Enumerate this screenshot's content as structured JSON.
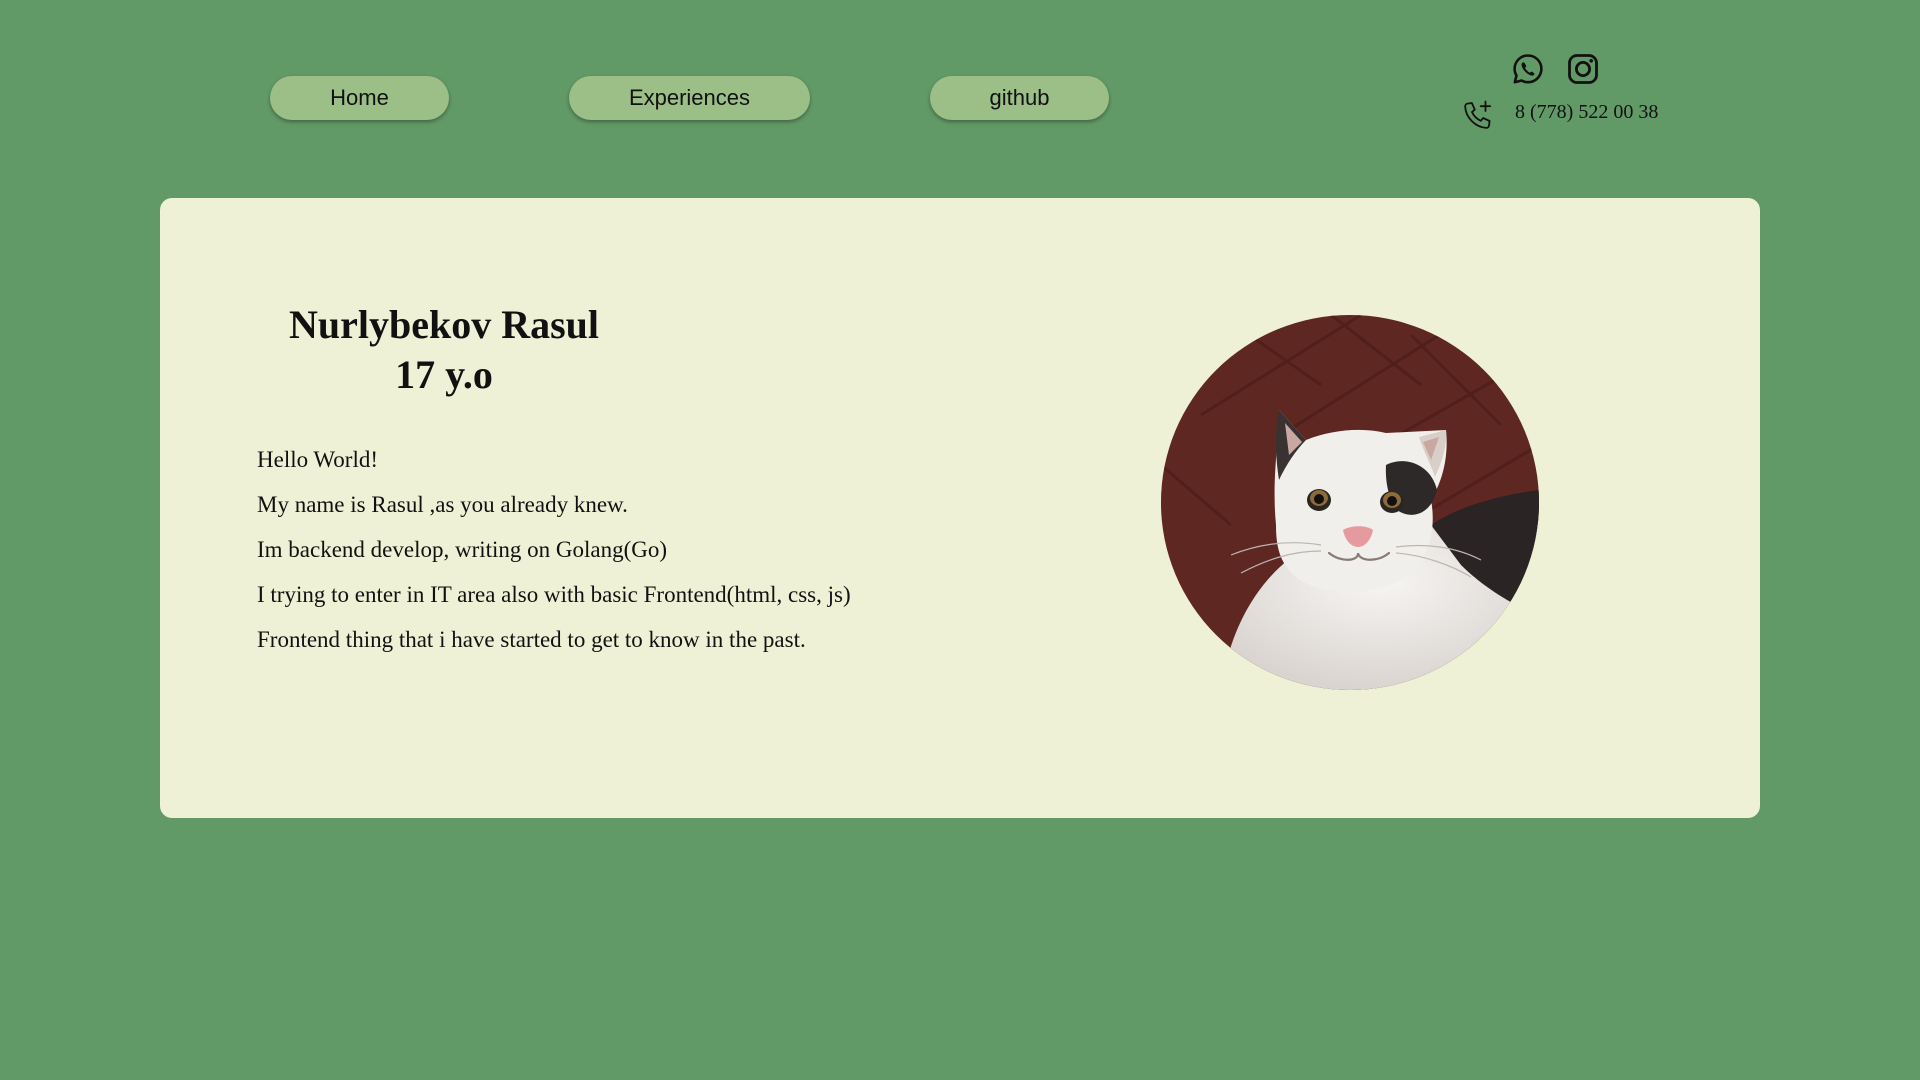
{
  "nav": {
    "home": "Home",
    "experiences": "Experiences",
    "github": "github"
  },
  "contact": {
    "whatsapp_icon": "whatsapp-icon",
    "instagram_icon": "instagram-icon",
    "phone_icon": "phone-plus-icon",
    "phone": "8 (778) 522 00 38"
  },
  "profile": {
    "name": "Nurlybekov Rasul",
    "age": "17 y.o",
    "bio": [
      "Hello World!",
      "My name is Rasul ,as you already knew.",
      "Im backend develop, writing on Golang(Go)",
      "I trying to enter in IT area also with basic Frontend(html, css, js)",
      "Frontend thing that i have started to get to know in the past."
    ]
  },
  "colors": {
    "background": "#629a67",
    "card": "#eef1d6",
    "button": "#9cbf88"
  }
}
